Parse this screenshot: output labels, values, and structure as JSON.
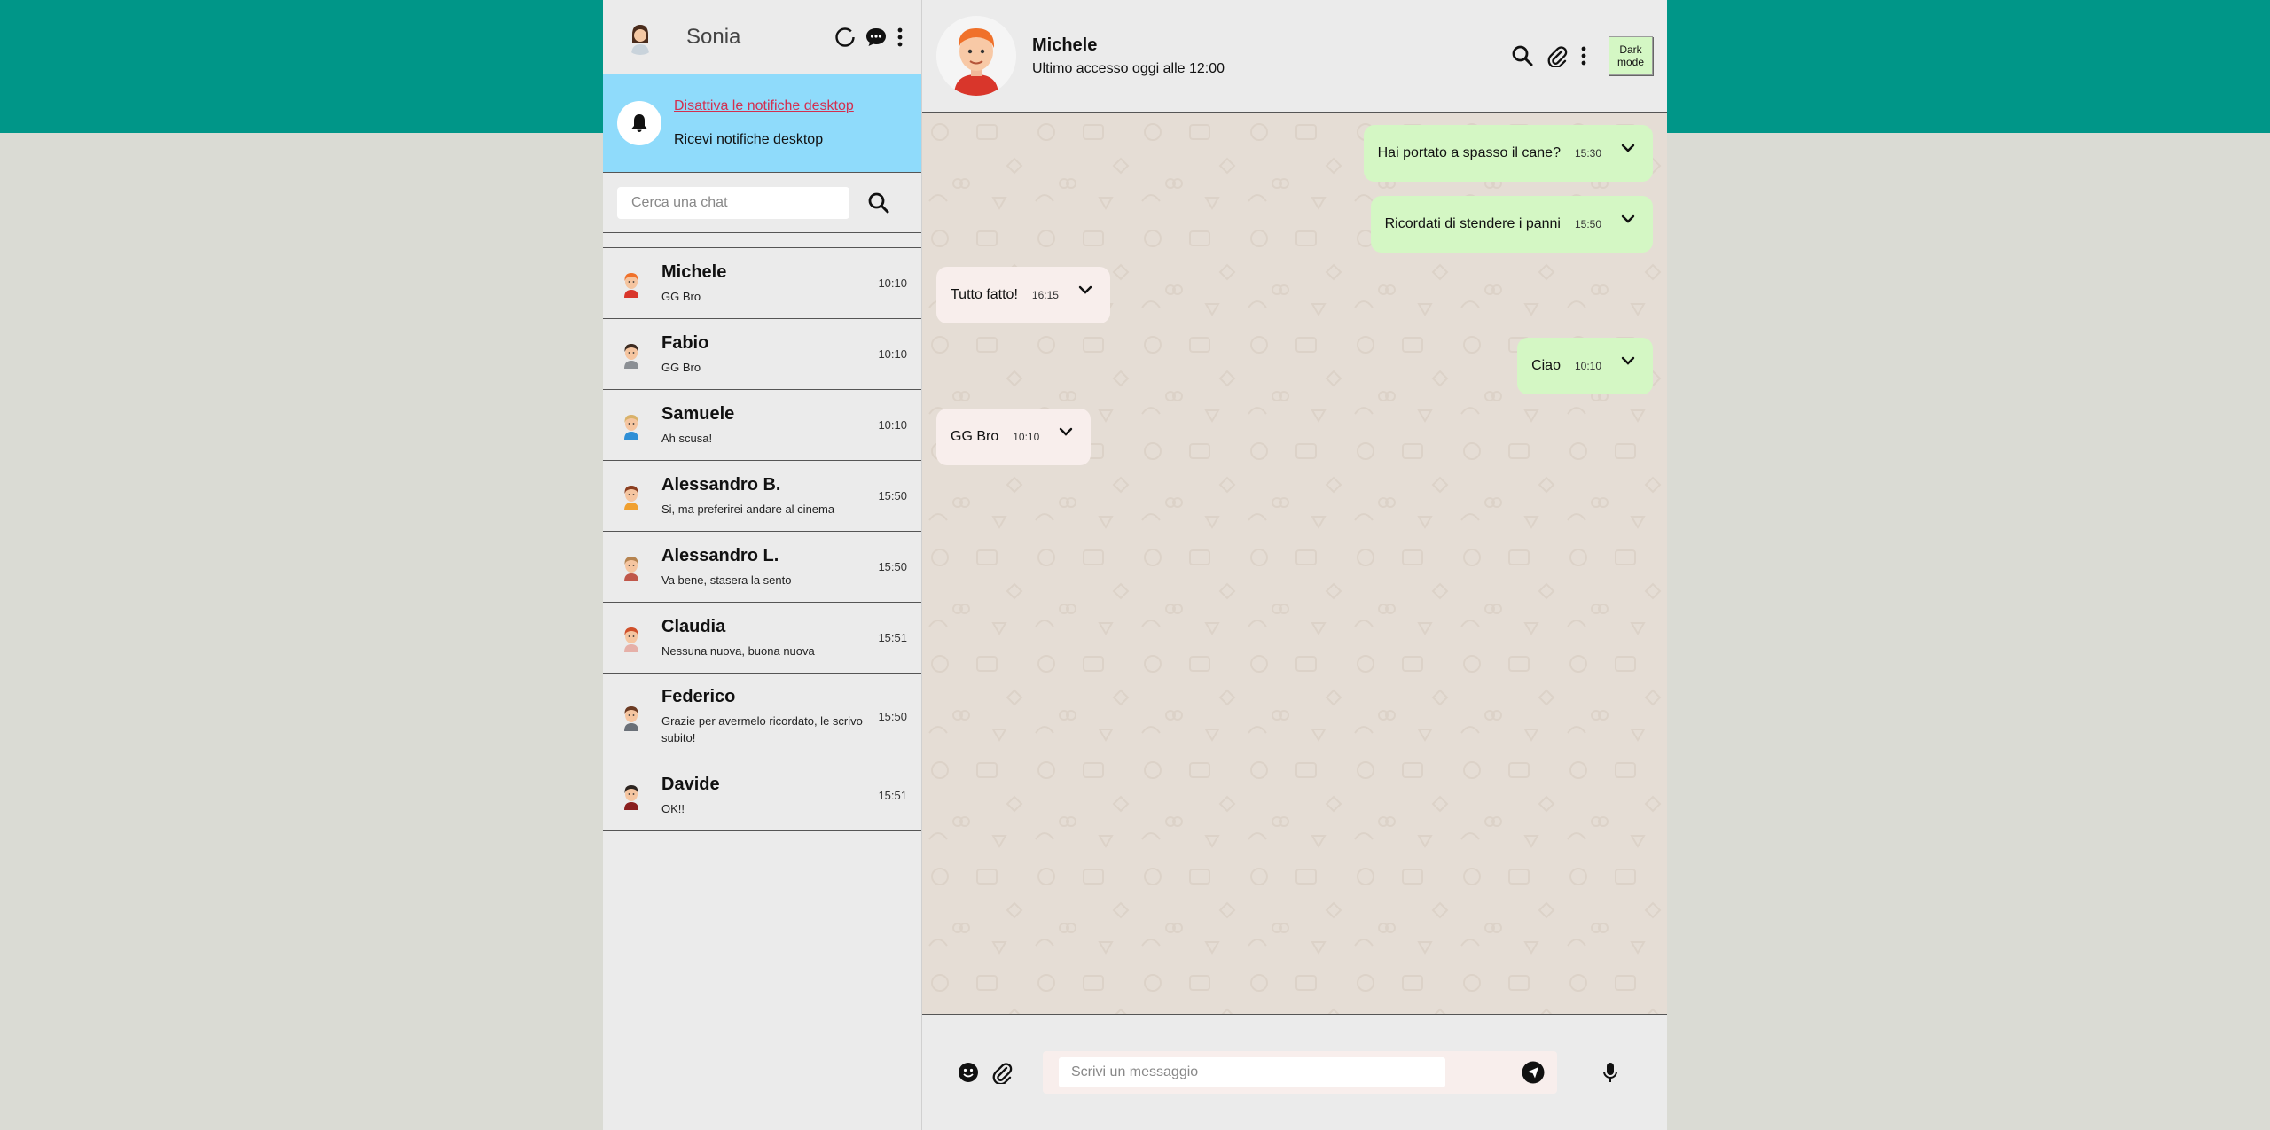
{
  "user": {
    "name": "Sonia"
  },
  "notifications": {
    "disable_link": "Disattiva le notifiche desktop",
    "text": "Ricevi notifiche desktop"
  },
  "search": {
    "placeholder": "Cerca una chat"
  },
  "chats": [
    {
      "name": "Michele",
      "last": "GG Bro",
      "time": "10:10",
      "hair": "#f0712a",
      "shirt": "#d9362b"
    },
    {
      "name": "Fabio",
      "last": "GG Bro",
      "time": "10:10",
      "hair": "#3b2a20",
      "shirt": "#8b8f94"
    },
    {
      "name": "Samuele",
      "last": "Ah scusa!",
      "time": "10:10",
      "hair": "#d9b26a",
      "shirt": "#2f8fd6"
    },
    {
      "name": "Alessandro B.",
      "last": "Si, ma preferirei andare al cinema",
      "time": "15:50",
      "hair": "#8a3d1f",
      "shirt": "#f0a030"
    },
    {
      "name": "Alessandro L.",
      "last": "Va bene, stasera la sento",
      "time": "15:50",
      "hair": "#b5834f",
      "shirt": "#c0574a"
    },
    {
      "name": "Claudia",
      "last": "Nessuna nuova, buona nuova",
      "time": "15:51",
      "hair": "#d0502a",
      "shirt": "#e6b0a8"
    },
    {
      "name": "Federico",
      "last": "Grazie per avermelo ricordato, le scrivo subito!",
      "time": "15:50",
      "hair": "#6b3a22",
      "shirt": "#6a7078"
    },
    {
      "name": "Davide",
      "last": "OK!!",
      "time": "15:51",
      "hair": "#2c2420",
      "shirt": "#8a1f1f"
    }
  ],
  "active_chat": {
    "name": "Michele",
    "status": "Ultimo accesso oggi alle 12:00"
  },
  "header": {
    "dark_mode_label": "Dark mode"
  },
  "messages": [
    {
      "direction": "out",
      "text": "Hai portato a spasso il cane?",
      "time": "15:30"
    },
    {
      "direction": "out",
      "text": "Ricordati di stendere i panni",
      "time": "15:50"
    },
    {
      "direction": "in",
      "text": "Tutto fatto!",
      "time": "16:15"
    },
    {
      "direction": "out",
      "text": "Ciao",
      "time": "10:10"
    },
    {
      "direction": "in",
      "text": "GG Bro",
      "time": "10:10"
    }
  ],
  "composer": {
    "placeholder": "Scrivi un messaggio"
  },
  "colors": {
    "brand_band": "#009688",
    "notif_bg": "#8fdbfb",
    "out_bubble": "#d4f7c4",
    "in_bubble": "#f8eeec",
    "link": "#d32f4f"
  },
  "icons": {
    "status": "status-ring-icon",
    "new_chat": "chat-bubble-icon",
    "menu": "kebab-menu-icon",
    "bell": "bell-icon",
    "search": "search-icon",
    "attach": "paperclip-icon",
    "emoji": "emoji-icon",
    "send": "send-icon",
    "mic": "microphone-icon",
    "chevron": "chevron-down-icon"
  }
}
